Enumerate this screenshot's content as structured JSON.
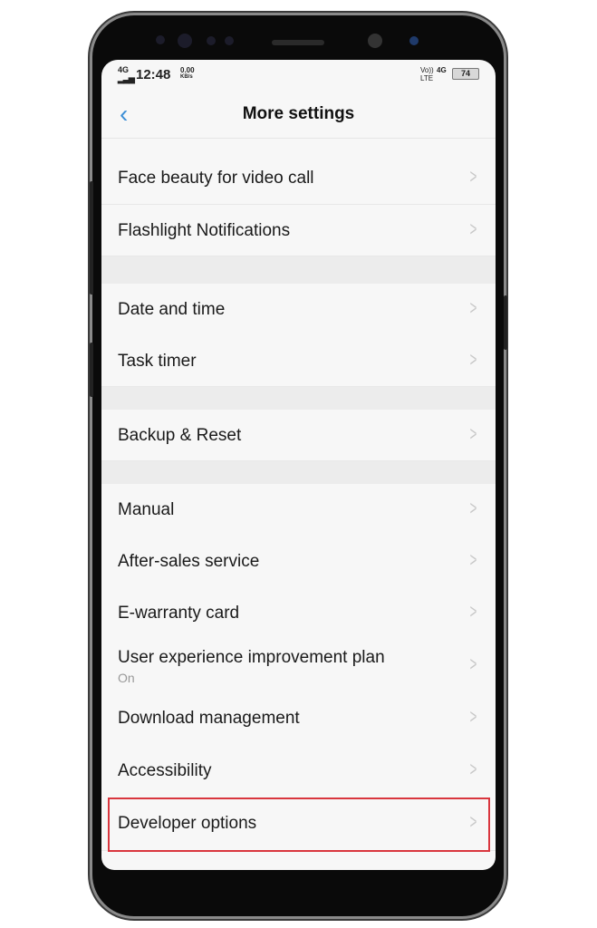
{
  "status_bar": {
    "network": "4G",
    "time": "12:48",
    "speed": "0.00",
    "speed_unit": "KB/s",
    "volte": "Vo))",
    "lte": "LTE",
    "network_right": "4G",
    "battery": "74"
  },
  "header": {
    "title": "More settings",
    "back_icon": "chevron-left-icon"
  },
  "items": [
    {
      "label": "Face beauty for video call"
    },
    {
      "label": "Flashlight Notifications"
    },
    {
      "label": "Date and time"
    },
    {
      "label": "Task timer"
    },
    {
      "label": "Backup & Reset"
    },
    {
      "label": "Manual"
    },
    {
      "label": "After-sales service"
    },
    {
      "label": "E-warranty card"
    },
    {
      "label": "User experience improvement plan",
      "sub": "On"
    },
    {
      "label": "Download management"
    },
    {
      "label": "Accessibility"
    },
    {
      "label": "Developer options"
    }
  ],
  "colors": {
    "accent": "#3d8fd6",
    "highlight": "#d9363e"
  }
}
